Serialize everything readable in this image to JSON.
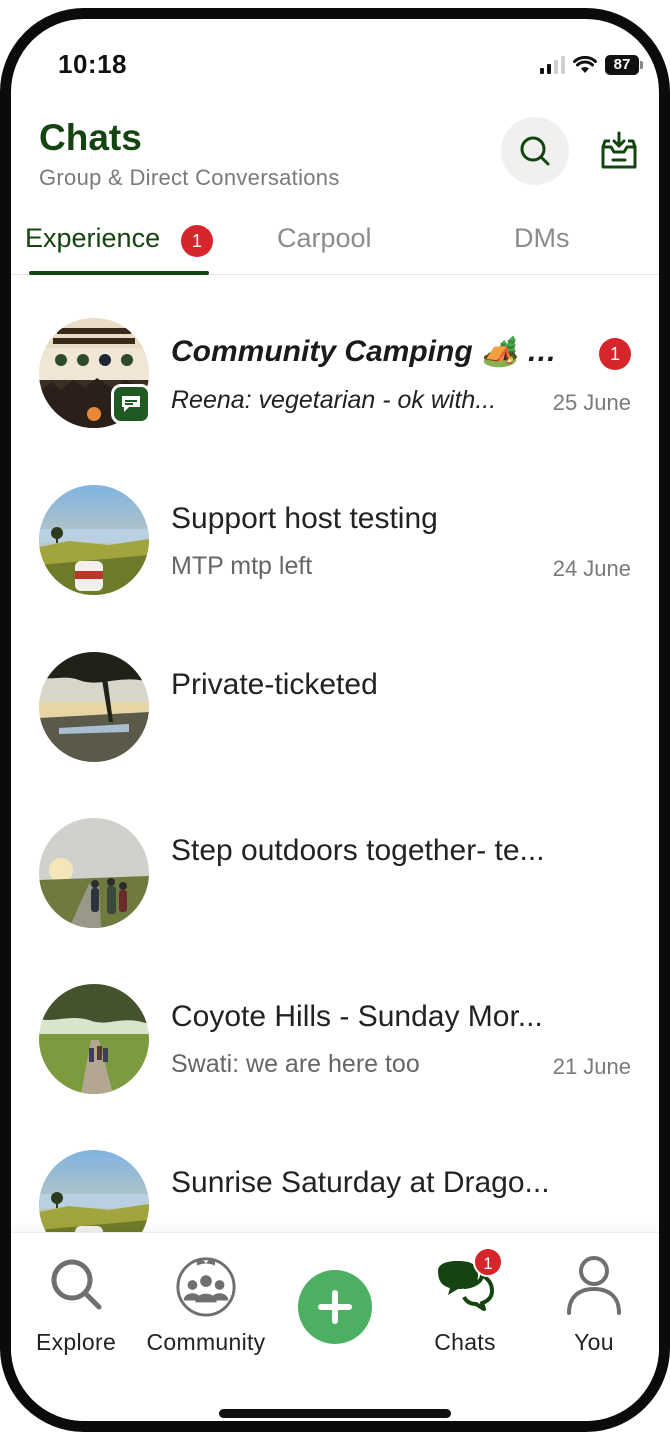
{
  "status_bar": {
    "time": "10:18",
    "battery": "87"
  },
  "header": {
    "title": "Chats",
    "subtitle": "Group & Direct Conversations"
  },
  "tabs": [
    {
      "label": "Experience",
      "badge": "1",
      "active": true
    },
    {
      "label": "Carpool",
      "active": false
    },
    {
      "label": "DMs",
      "active": false
    }
  ],
  "chats": [
    {
      "name": "Community Camping 🏕️ Ex...",
      "preview": "Reena: vegetarian - ok with...",
      "date": "25 June",
      "unread": "1",
      "bold": true
    },
    {
      "name": "Support host testing",
      "preview": "MTP mtp left",
      "date": "24 June"
    },
    {
      "name": "Private-ticketed",
      "preview": "",
      "date": ""
    },
    {
      "name": "Step outdoors together- te...",
      "preview": "",
      "date": ""
    },
    {
      "name": "Coyote Hills - Sunday Mor...",
      "preview": "Swati: we are here too",
      "date": "21 June"
    },
    {
      "name": "Sunrise Saturday at Drago...",
      "preview": "",
      "date": ""
    }
  ],
  "bottom_nav": {
    "explore": "Explore",
    "community": "Community",
    "chats": "Chats",
    "chats_badge": "1",
    "you": "You"
  },
  "colors": {
    "brand_green": "#14440f",
    "accent_green": "#4caf61",
    "badge_red": "#d7262b"
  }
}
